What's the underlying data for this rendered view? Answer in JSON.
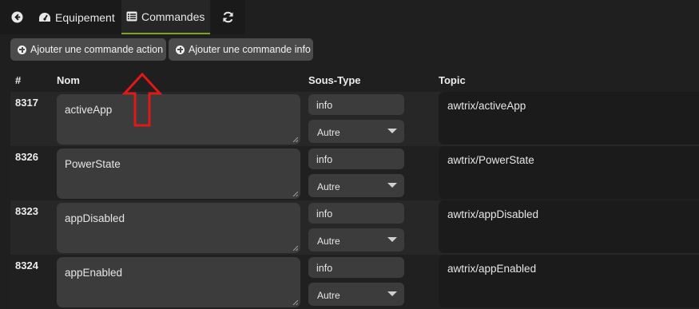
{
  "tabs": {
    "back_icon": "arrow-circle-left-icon",
    "equipement": "Equipement",
    "commandes": "Commandes",
    "refresh_icon": "refresh-icon"
  },
  "buttons": {
    "add_action": "Ajouter une commande action",
    "add_info": "Ajouter une commande info"
  },
  "columns": {
    "id": "#",
    "name": "Nom",
    "subtype": "Sous-Type",
    "topic": "Topic"
  },
  "rows": [
    {
      "id": "8317",
      "name": "activeApp",
      "type": "info",
      "subtype": "Autre",
      "topic": "awtrix/activeApp"
    },
    {
      "id": "8326",
      "name": "PowerState",
      "type": "info",
      "subtype": "Autre",
      "topic": "awtrix/PowerState"
    },
    {
      "id": "8323",
      "name": "appDisabled",
      "type": "info",
      "subtype": "Autre",
      "topic": "awtrix/appDisabled"
    },
    {
      "id": "8324",
      "name": "appEnabled",
      "type": "info",
      "subtype": "Autre",
      "topic": "awtrix/appEnabled"
    }
  ],
  "colors": {
    "accent": "#7ea41b",
    "annotation": "#e01818"
  }
}
